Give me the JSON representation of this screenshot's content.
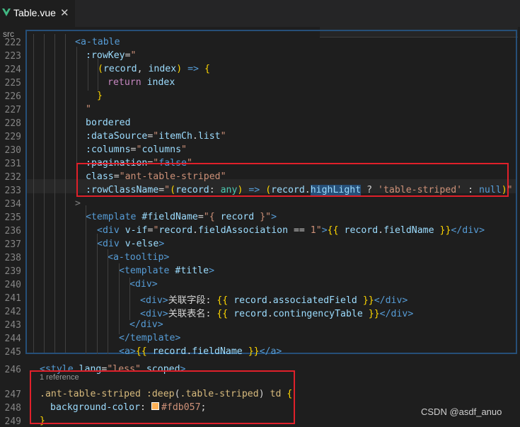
{
  "tab": {
    "title": "Table.vue",
    "close": "✕",
    "icon": "vue-icon"
  },
  "breadcrumb": "src",
  "codelens": "1 reference",
  "watermark": "CSDN @asdf_anuo",
  "colors": {
    "highlight_box": "#e0202a",
    "swatch": "#fdb057",
    "background": "#1e1e1e"
  },
  "lines": [
    {
      "n": "222",
      "tokens": [
        [
          "tag",
          "<a-table"
        ]
      ]
    },
    {
      "n": "223",
      "tokens": [
        [
          "attr",
          ":rowKey"
        ],
        [
          "txt",
          "="
        ],
        [
          "str",
          "\""
        ]
      ]
    },
    {
      "n": "224",
      "tokens": [
        [
          "yel",
          "("
        ],
        [
          "var",
          "record"
        ],
        [
          "txt",
          ", "
        ],
        [
          "var",
          "index"
        ],
        [
          "yel",
          ")"
        ],
        [
          "txt",
          " "
        ],
        [
          "tag",
          "=>"
        ],
        [
          "txt",
          " "
        ],
        [
          "yel",
          "{"
        ]
      ]
    },
    {
      "n": "225",
      "tokens": [
        [
          "ctrl",
          "return"
        ],
        [
          "txt",
          " "
        ],
        [
          "var",
          "index"
        ]
      ]
    },
    {
      "n": "226",
      "tokens": [
        [
          "yel",
          "}"
        ]
      ]
    },
    {
      "n": "227",
      "tokens": [
        [
          "str",
          "\""
        ]
      ]
    },
    {
      "n": "228",
      "tokens": [
        [
          "attr",
          "bordered"
        ]
      ]
    },
    {
      "n": "229",
      "tokens": [
        [
          "attr",
          ":dataSource"
        ],
        [
          "txt",
          "="
        ],
        [
          "str",
          "\""
        ],
        [
          "var",
          "itemCh"
        ],
        [
          "txt",
          "."
        ],
        [
          "var",
          "list"
        ],
        [
          "str",
          "\""
        ]
      ]
    },
    {
      "n": "230",
      "tokens": [
        [
          "attr",
          ":columns"
        ],
        [
          "txt",
          "="
        ],
        [
          "str",
          "\""
        ],
        [
          "var",
          "columns"
        ],
        [
          "str",
          "\""
        ]
      ]
    },
    {
      "n": "231",
      "tokens": [
        [
          "attr",
          ":pagination"
        ],
        [
          "txt",
          "="
        ],
        [
          "str",
          "\""
        ],
        [
          "tag",
          "false"
        ],
        [
          "str",
          "\""
        ]
      ]
    },
    {
      "n": "232",
      "tokens": [
        [
          "attr",
          "class"
        ],
        [
          "txt",
          "="
        ],
        [
          "str",
          "\"ant-table-striped\""
        ]
      ]
    },
    {
      "n": "233",
      "tokens": [
        [
          "attr",
          ":rowClassName"
        ],
        [
          "txt",
          "="
        ],
        [
          "str",
          "\""
        ],
        [
          "yel",
          "("
        ],
        [
          "var",
          "record"
        ],
        [
          "txt",
          ": "
        ],
        [
          "type",
          "any"
        ],
        [
          "yel",
          ")"
        ],
        [
          "txt",
          " "
        ],
        [
          "tag",
          "=>"
        ],
        [
          "txt",
          " "
        ],
        [
          "yel",
          "("
        ],
        [
          "var",
          "record"
        ],
        [
          "txt",
          "."
        ],
        [
          "hl",
          "highLight"
        ],
        [
          "txt",
          " ? "
        ],
        [
          "str",
          "'table-striped'"
        ],
        [
          "txt",
          " : "
        ],
        [
          "tag",
          "null"
        ],
        [
          "yel",
          ")"
        ],
        [
          "str",
          "\""
        ]
      ]
    },
    {
      "n": "234",
      "tokens": [
        [
          "punct",
          ">"
        ]
      ]
    },
    {
      "n": "235",
      "tokens": [
        [
          "tag",
          "<template"
        ],
        [
          "txt",
          " "
        ],
        [
          "attr",
          "#fieldName"
        ],
        [
          "txt",
          "="
        ],
        [
          "str",
          "\"{ "
        ],
        [
          "var",
          "record"
        ],
        [
          "str",
          " }\""
        ],
        [
          "tag",
          ">"
        ]
      ]
    },
    {
      "n": "236",
      "tokens": [
        [
          "tag",
          "<div"
        ],
        [
          "txt",
          " "
        ],
        [
          "attr",
          "v-if"
        ],
        [
          "txt",
          "="
        ],
        [
          "str",
          "\""
        ],
        [
          "var",
          "record"
        ],
        [
          "txt",
          "."
        ],
        [
          "var",
          "fieldAssociation"
        ],
        [
          "txt",
          " == "
        ],
        [
          "str",
          "1"
        ],
        [
          "str",
          "\""
        ],
        [
          "tag",
          ">"
        ],
        [
          "yel",
          "{{"
        ],
        [
          "txt",
          " "
        ],
        [
          "var",
          "record"
        ],
        [
          "txt",
          "."
        ],
        [
          "var",
          "fieldName"
        ],
        [
          "txt",
          " "
        ],
        [
          "yel",
          "}}"
        ],
        [
          "tag",
          "</div>"
        ]
      ]
    },
    {
      "n": "237",
      "tokens": [
        [
          "tag",
          "<div"
        ],
        [
          "txt",
          " "
        ],
        [
          "attr",
          "v-else"
        ],
        [
          "tag",
          ">"
        ]
      ]
    },
    {
      "n": "238",
      "tokens": [
        [
          "tag",
          "<a-tooltip>"
        ]
      ]
    },
    {
      "n": "239",
      "tokens": [
        [
          "tag",
          "<template"
        ],
        [
          "txt",
          " "
        ],
        [
          "attr",
          "#title"
        ],
        [
          "tag",
          ">"
        ]
      ]
    },
    {
      "n": "240",
      "tokens": [
        [
          "tag",
          "<div>"
        ]
      ]
    },
    {
      "n": "241",
      "tokens": [
        [
          "tag",
          "<div>"
        ],
        [
          "txt",
          "关联字段: "
        ],
        [
          "yel",
          "{{"
        ],
        [
          "txt",
          " "
        ],
        [
          "var",
          "record"
        ],
        [
          "txt",
          "."
        ],
        [
          "var",
          "associatedField"
        ],
        [
          "txt",
          " "
        ],
        [
          "yel",
          "}}"
        ],
        [
          "tag",
          "</div>"
        ]
      ]
    },
    {
      "n": "242",
      "tokens": [
        [
          "tag",
          "<div>"
        ],
        [
          "txt",
          "关联表名: "
        ],
        [
          "yel",
          "{{"
        ],
        [
          "txt",
          " "
        ],
        [
          "var",
          "record"
        ],
        [
          "txt",
          "."
        ],
        [
          "var",
          "contingencyTable"
        ],
        [
          "txt",
          " "
        ],
        [
          "yel",
          "}}"
        ],
        [
          "tag",
          "</div>"
        ]
      ]
    },
    {
      "n": "243",
      "tokens": [
        [
          "tag",
          "</div>"
        ]
      ]
    },
    {
      "n": "244",
      "tokens": [
        [
          "tag",
          "</template>"
        ]
      ]
    },
    {
      "n": "245",
      "tokens": [
        [
          "tag",
          "<a>"
        ],
        [
          "yel",
          "{{"
        ],
        [
          "txt",
          " "
        ],
        [
          "var",
          "record"
        ],
        [
          "txt",
          "."
        ],
        [
          "var",
          "fieldName"
        ],
        [
          "txt",
          " "
        ],
        [
          "yel",
          "}}"
        ],
        [
          "tag",
          "</a>"
        ]
      ]
    },
    {
      "n": "246",
      "tokens": [
        [
          "tag",
          "<style"
        ],
        [
          "txt",
          " "
        ],
        [
          "attr",
          "lang"
        ],
        [
          "txt",
          "="
        ],
        [
          "str",
          "\"less\""
        ],
        [
          "txt",
          " "
        ],
        [
          "attr",
          "scoped"
        ],
        [
          "tag",
          ">"
        ]
      ]
    },
    {
      "n": "247",
      "tokens": [
        [
          "sel",
          ".ant-table-striped"
        ],
        [
          "txt",
          " "
        ],
        [
          "sel",
          ":deep"
        ],
        [
          "txt",
          "("
        ],
        [
          "sel",
          ".table-striped"
        ],
        [
          "txt",
          ") "
        ],
        [
          "sel",
          "td"
        ],
        [
          "txt",
          " "
        ],
        [
          "yel",
          "{"
        ]
      ]
    },
    {
      "n": "248",
      "tokens": [
        [
          "attr",
          "background-color"
        ],
        [
          "txt",
          ": "
        ],
        [
          "swatch",
          ""
        ],
        [
          "str",
          "#fdb057"
        ],
        [
          "txt",
          ";"
        ]
      ]
    },
    {
      "n": "249",
      "tokens": [
        [
          "yel",
          "}"
        ]
      ]
    }
  ]
}
